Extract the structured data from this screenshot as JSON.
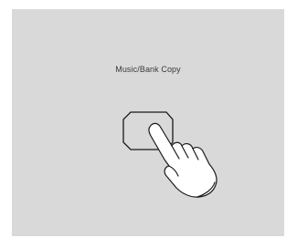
{
  "panel": {
    "title": "Music/Bank Copy",
    "background": "#d9d9d9"
  },
  "illustration": {
    "button_icon": "octagon-button-icon",
    "hand_icon": "pointing-hand-icon"
  }
}
